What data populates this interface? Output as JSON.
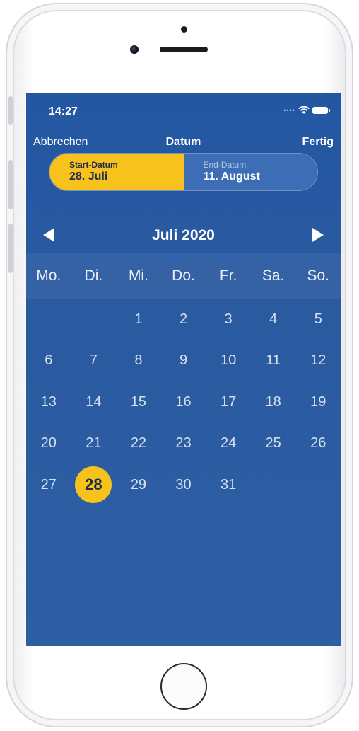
{
  "status": {
    "time": "14:27",
    "signal_icon": "signal-dots-icon",
    "wifi_icon": "wifi-icon",
    "battery_icon": "battery-icon"
  },
  "nav": {
    "cancel": "Abbrechen",
    "title": "Datum",
    "done": "Fertig"
  },
  "range": {
    "start_caption": "Start-Datum",
    "start_value": "28. Juli",
    "end_caption": "End-Datum",
    "end_value": "11. August",
    "accent": "#f7c21b"
  },
  "calendar": {
    "month_label": "Juli 2020",
    "prev_icon": "triangle-left-icon",
    "next_icon": "triangle-right-icon",
    "weekdays": [
      "Mo.",
      "Di.",
      "Mi.",
      "Do.",
      "Fr.",
      "Sa.",
      "So."
    ],
    "weeks": [
      [
        "",
        "",
        "1",
        "2",
        "3",
        "4",
        "5"
      ],
      [
        "6",
        "7",
        "8",
        "9",
        "10",
        "11",
        "12"
      ],
      [
        "13",
        "14",
        "15",
        "16",
        "17",
        "18",
        "19"
      ],
      [
        "20",
        "21",
        "22",
        "23",
        "24",
        "25",
        "26"
      ],
      [
        "27",
        "28",
        "29",
        "30",
        "31",
        "",
        ""
      ]
    ],
    "selected_day": "28"
  }
}
